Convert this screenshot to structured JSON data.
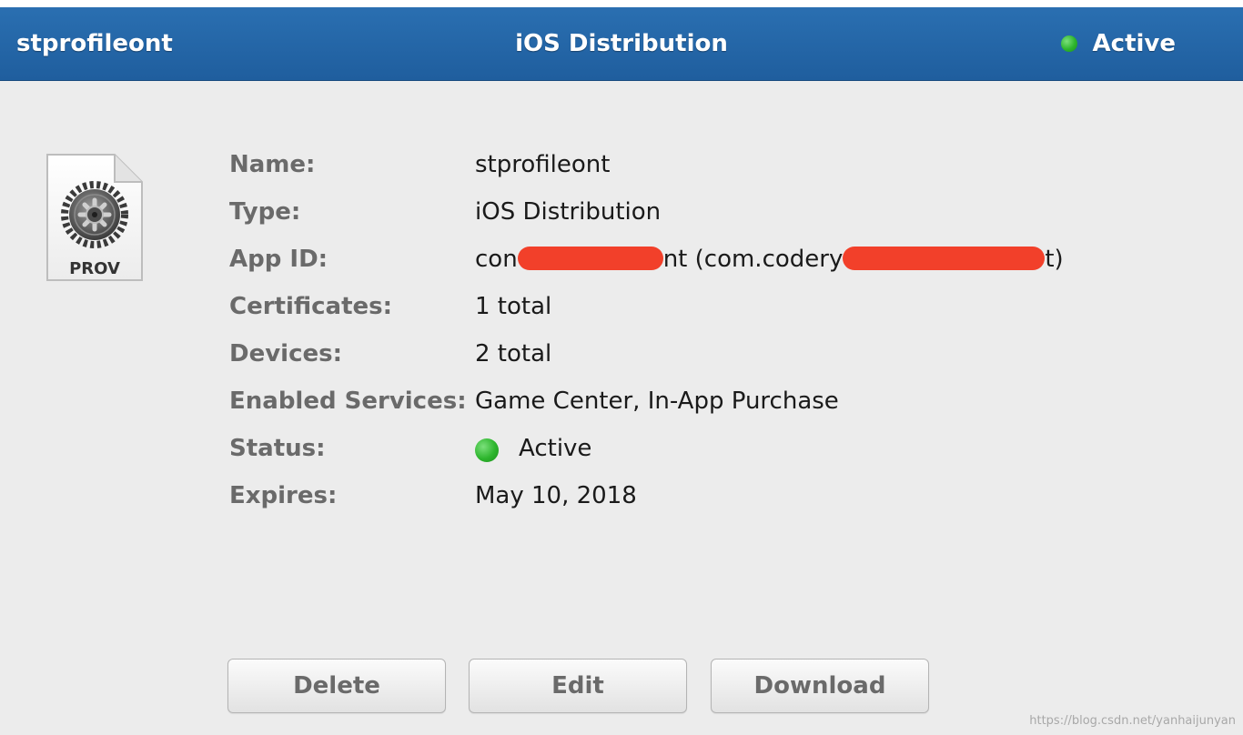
{
  "header": {
    "profile_name": "stprofileont",
    "title": "iOS Distribution",
    "status": "Active",
    "status_color": "#2db52d",
    "bar_color": "#2a6fb1"
  },
  "file_icon": {
    "icon": "provisioning-profile-file-icon",
    "badge": "PROV"
  },
  "details": {
    "name": {
      "label": "Name:",
      "value": "stprofileont"
    },
    "type": {
      "label": "Type:",
      "value": "iOS Distribution"
    },
    "app_id": {
      "label": "App ID:",
      "prefix": "con",
      "middle": "nt (com.codery",
      "suffix": "t)",
      "redaction_color": "#f2402a"
    },
    "certificates": {
      "label": "Certificates:",
      "value": "1 total"
    },
    "devices": {
      "label": "Devices:",
      "value": "2 total"
    },
    "enabled_services": {
      "label": "Enabled Services:",
      "value": "Game Center, In-App Purchase"
    },
    "status": {
      "label": "Status:",
      "value": "Active"
    },
    "expires": {
      "label": "Expires:",
      "value": "May 10, 2018"
    }
  },
  "buttons": {
    "delete": "Delete",
    "edit": "Edit",
    "download": "Download"
  },
  "watermark": "https://blog.csdn.net/yanhaijunyan"
}
